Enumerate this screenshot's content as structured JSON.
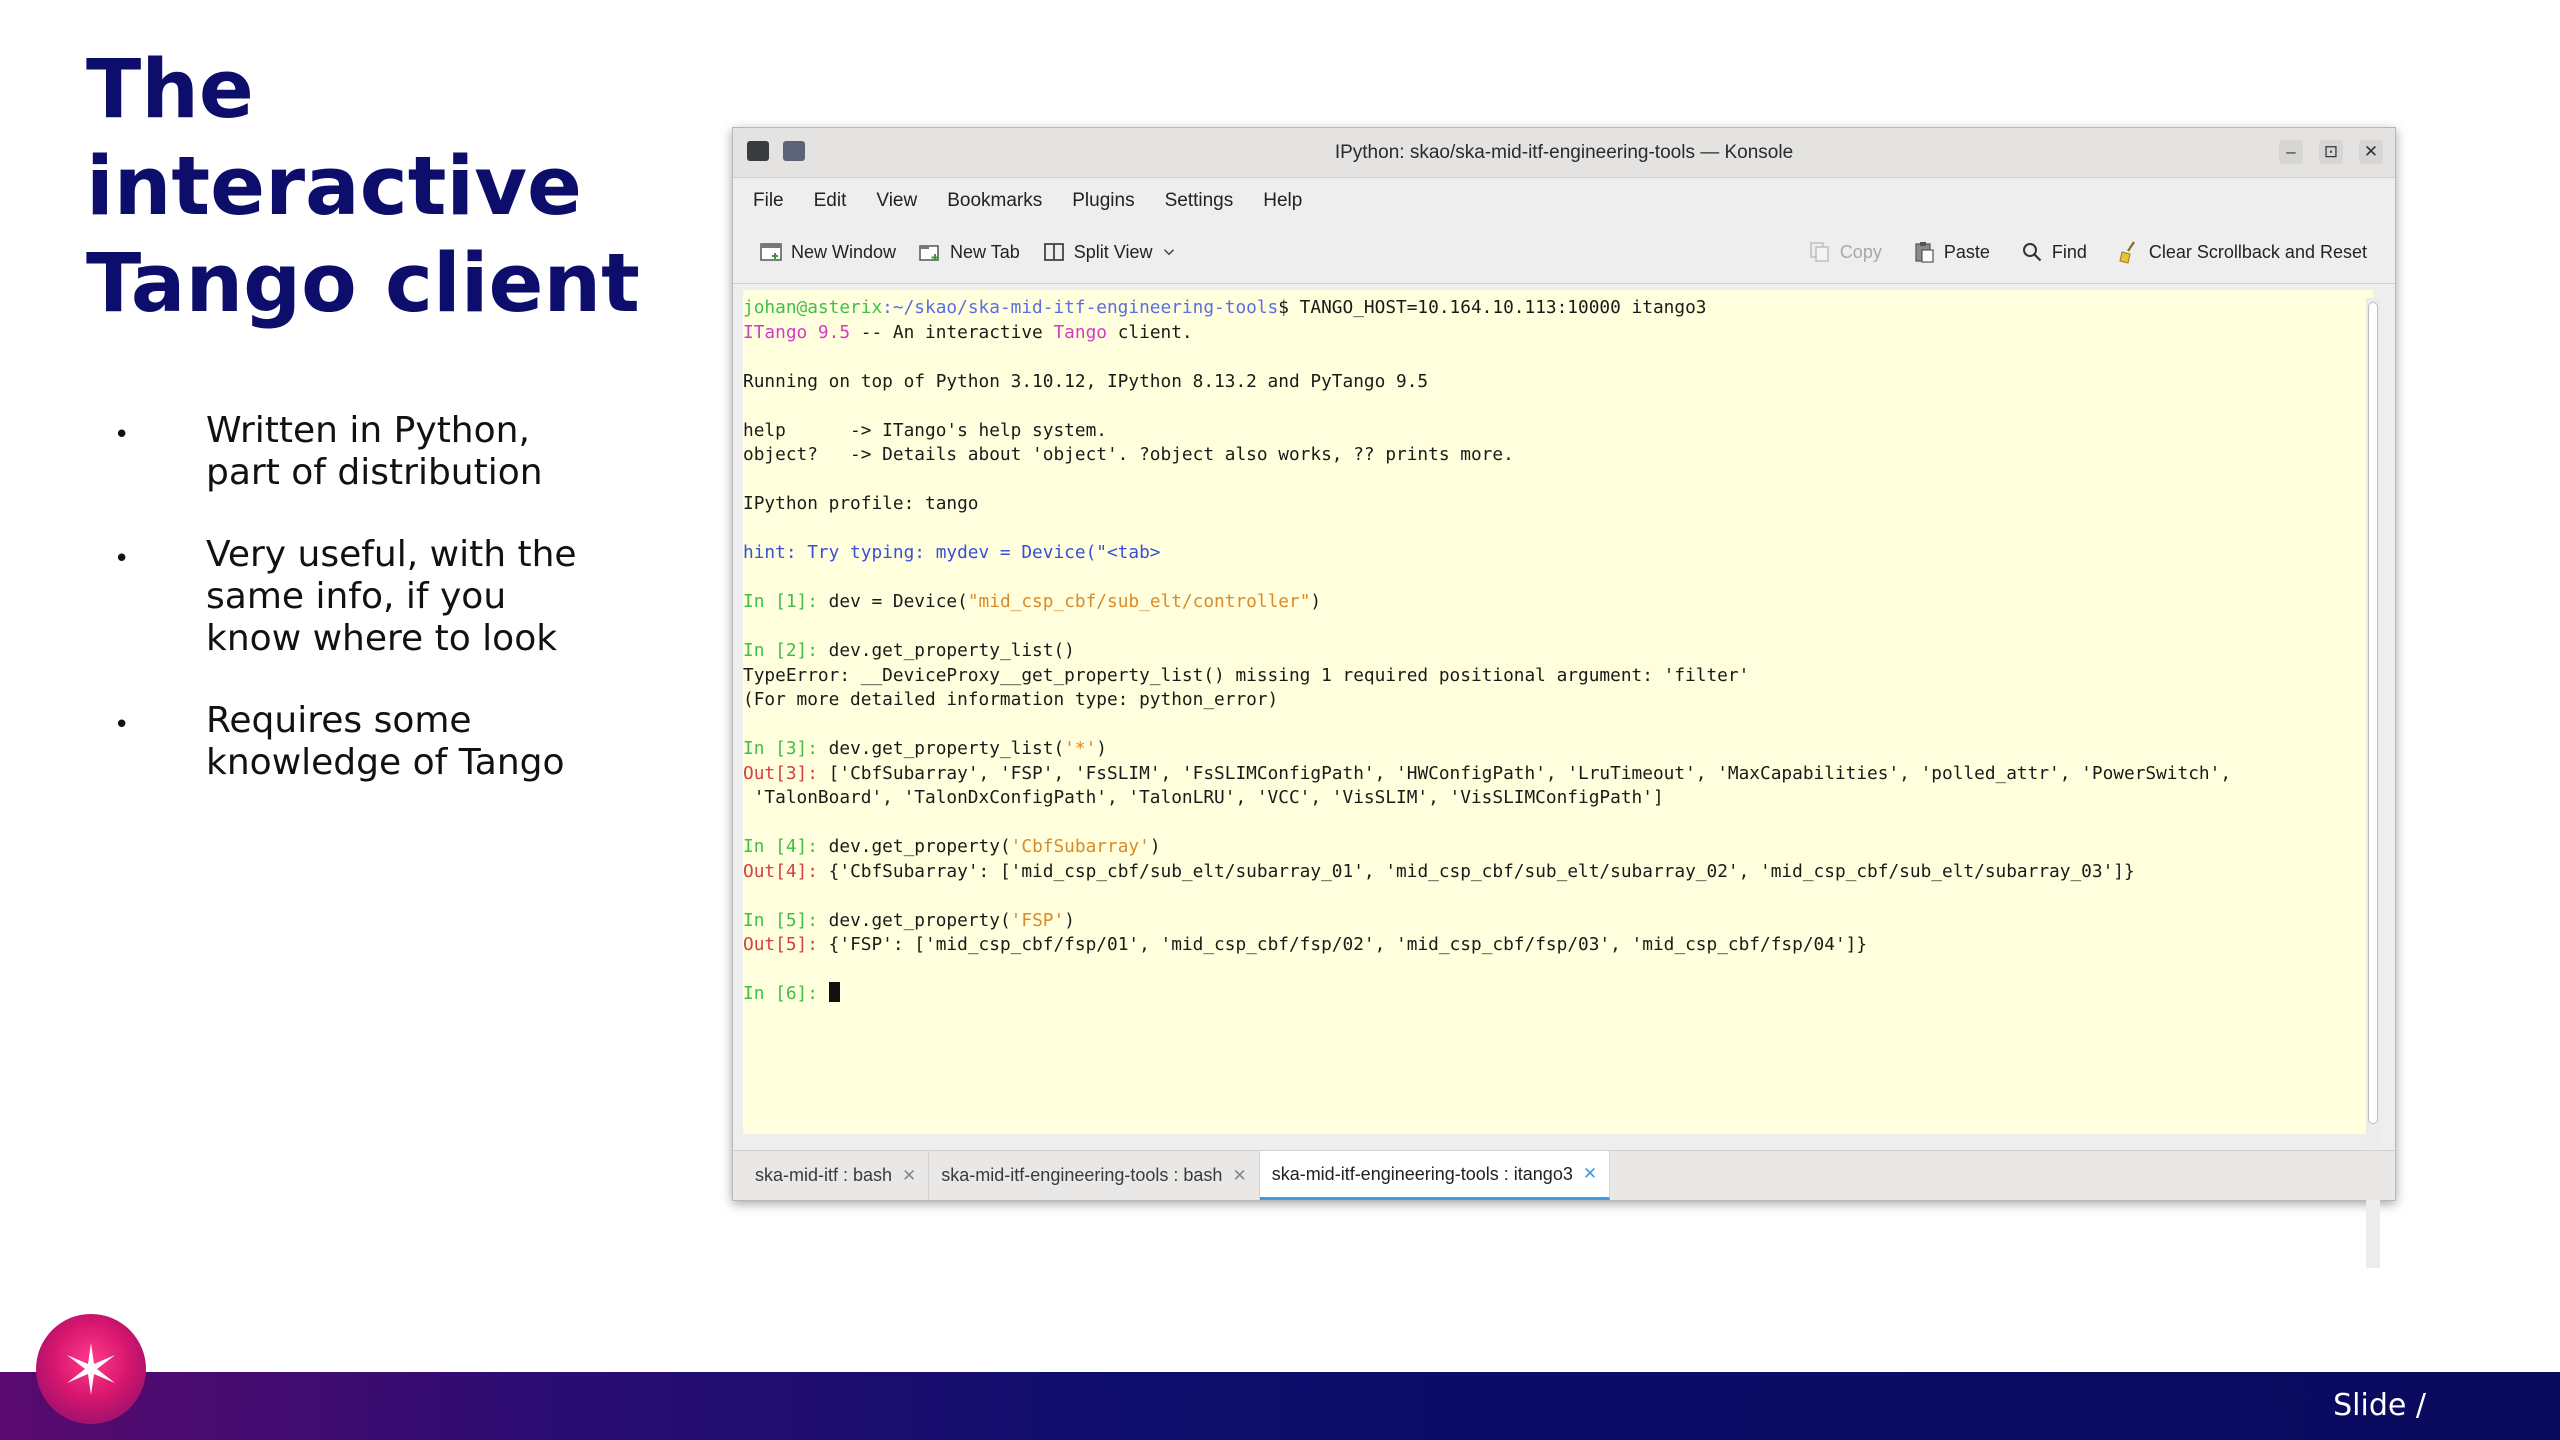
{
  "slide": {
    "title_lines": [
      "The",
      "interactive",
      "Tango client"
    ],
    "bullets": [
      [
        "Written in Python,",
        "part of distribution"
      ],
      [
        "Very useful, with the",
        "same info, if you",
        "know where to look"
      ],
      [
        "Requires some",
        "knowledge of Tango"
      ]
    ],
    "bullet_glyph": "•",
    "slide_label": "Slide  /"
  },
  "window": {
    "title": "IPython: skao/ska-mid-itf-engineering-tools — Konsole",
    "controls": {
      "minimize": "–",
      "maximize": "⊡",
      "close": "✕"
    }
  },
  "menubar": [
    "File",
    "Edit",
    "View",
    "Bookmarks",
    "Plugins",
    "Settings",
    "Help"
  ],
  "toolbar": {
    "new_window": "New Window",
    "new_tab": "New Tab",
    "split_view": "Split View",
    "copy": "Copy",
    "paste": "Paste",
    "find": "Find",
    "clear": "Clear Scrollback and Reset"
  },
  "terminal": {
    "lines": [
      [
        {
          "t": "johan@asterix",
          "c": "green"
        },
        {
          "t": ":~/skao/ska-mid-itf-engineering-tools",
          "c": "path"
        },
        {
          "t": "$ TANGO_HOST=10.164.10.113:10000 itango3"
        }
      ],
      [
        {
          "t": "ITango 9.5",
          "c": "mag"
        },
        {
          "t": " -- An interactive "
        },
        {
          "t": "Tango",
          "c": "mag"
        },
        {
          "t": " client."
        }
      ],
      [],
      [
        {
          "t": "Running on top of Python 3.10.12, IPython 8.13.2 and PyTango 9.5"
        }
      ],
      [],
      [
        {
          "t": "help      -> ITango's help system."
        }
      ],
      [
        {
          "t": "object?   -> Details about 'object'. ?object also works, ?? prints more."
        }
      ],
      [],
      [
        {
          "t": "IPython profile: tango"
        }
      ],
      [],
      [
        {
          "t": "hint: Try typing: mydev = Device(\"<tab>",
          "c": "blue"
        }
      ],
      [],
      [
        {
          "t": "In [1]: ",
          "c": "green"
        },
        {
          "t": "dev = Device("
        },
        {
          "t": "\"mid_csp_cbf/sub_elt/controller\"",
          "c": "orange"
        },
        {
          "t": ")"
        }
      ],
      [],
      [
        {
          "t": "In [2]: ",
          "c": "green"
        },
        {
          "t": "dev.get_property_list()"
        }
      ],
      [
        {
          "t": "TypeError: __DeviceProxy__get_property_list() missing 1 required positional argument: 'filter'"
        }
      ],
      [
        {
          "t": "(For more detailed information type: python_error)"
        }
      ],
      [],
      [
        {
          "t": "In [3]: ",
          "c": "green"
        },
        {
          "t": "dev.get_property_list("
        },
        {
          "t": "'*'",
          "c": "orange"
        },
        {
          "t": ")"
        }
      ],
      [
        {
          "t": "Out[3]: ",
          "c": "red"
        },
        {
          "t": "['CbfSubarray', 'FSP', 'FsSLIM', 'FsSLIMConfigPath', 'HWConfigPath', 'LruTimeout', 'MaxCapabilities', 'polled_attr', 'PowerSwitch',"
        }
      ],
      [
        {
          "t": " 'TalonBoard', 'TalonDxConfigPath', 'TalonLRU', 'VCC', 'VisSLIM', 'VisSLIMConfigPath']"
        }
      ],
      [],
      [
        {
          "t": "In [4]: ",
          "c": "green"
        },
        {
          "t": "dev.get_property("
        },
        {
          "t": "'CbfSubarray'",
          "c": "orange"
        },
        {
          "t": ")"
        }
      ],
      [
        {
          "t": "Out[4]: ",
          "c": "red"
        },
        {
          "t": "{'CbfSubarray': ['mid_csp_cbf/sub_elt/subarray_01', 'mid_csp_cbf/sub_elt/subarray_02', 'mid_csp_cbf/sub_elt/subarray_03']}"
        }
      ],
      [],
      [
        {
          "t": "In [5]: ",
          "c": "green"
        },
        {
          "t": "dev.get_property("
        },
        {
          "t": "'FSP'",
          "c": "orange"
        },
        {
          "t": ")"
        }
      ],
      [
        {
          "t": "Out[5]: ",
          "c": "red"
        },
        {
          "t": "{'FSP': ['mid_csp_cbf/fsp/01', 'mid_csp_cbf/fsp/02', 'mid_csp_cbf/fsp/03', 'mid_csp_cbf/fsp/04']}"
        }
      ],
      [],
      [
        {
          "t": "In [6]: ",
          "c": "green"
        },
        {
          "cursor": true
        }
      ]
    ]
  },
  "tabs": [
    {
      "label": "ska-mid-itf : bash",
      "active": false
    },
    {
      "label": "ska-mid-itf-engineering-tools : bash",
      "active": false
    },
    {
      "label": "ska-mid-itf-engineering-tools : itango3",
      "active": true
    }
  ],
  "tab_close_glyph": "✕",
  "colors": {
    "title": "#0d0d6b",
    "terminal_bg": "#ffffdd",
    "prompt_in": "#3fbf4a",
    "prompt_out": "#d44040",
    "string": "#d98a2a",
    "brand_magenta": "#d6166d",
    "footer": "#0d0d6b"
  },
  "icons": {
    "logo": "star-burst-icon",
    "new_window": "new-window-icon",
    "new_tab": "new-tab-icon",
    "split_view": "split-view-icon",
    "copy": "copy-icon",
    "paste": "paste-icon",
    "find": "search-icon",
    "clear": "broom-icon"
  }
}
